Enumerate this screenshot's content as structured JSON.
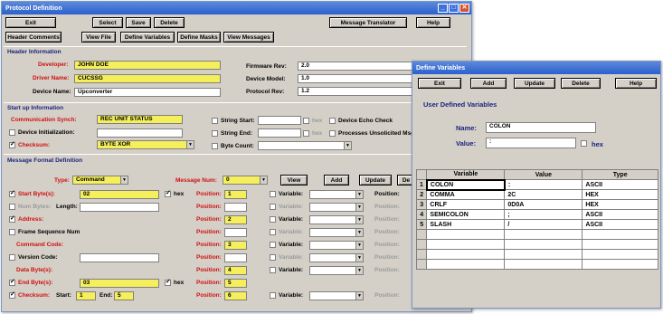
{
  "pd": {
    "title": "Protocol Definition",
    "toolbar1": {
      "exit": "Exit",
      "select": "Select",
      "save": "Save",
      "delete": "Delete",
      "msg_translator": "Message Translator",
      "help": "Help"
    },
    "toolbar2": {
      "header_comments": "Header Comments",
      "view_file": "View File",
      "define_variables": "Define Variables",
      "define_masks": "Define Masks",
      "view_messages": "View Messages"
    },
    "header": {
      "section": "Header Information",
      "developer_label": "Developer:",
      "developer": "JOHN DOE",
      "driver_label": "Driver Name:",
      "driver": "CUCSSG",
      "device_label": "Device Name:",
      "device": "Upconverter",
      "firmware_label": "Firmware Rev:",
      "firmware": "2.0",
      "model_label": "Device Model:",
      "model": "1.0",
      "protocol_label": "Protocol Rev:",
      "protocol": "1.2"
    },
    "startup": {
      "section": "Start up Information",
      "comm_label": "Communication Synch:",
      "comm": "REC UNIT STATUS",
      "devinit_label": "Device Initialization:",
      "checksum_label": "Checksum:",
      "checksum": "BYTE XOR",
      "string_start": "String Start:",
      "string_end": "String End:",
      "byte_count": "Byte Count:",
      "hex": "hex",
      "echo": "Device Echo Check",
      "unsolicited": "Processes Unsolicited Msg"
    },
    "format": {
      "section": "Message Format Definition",
      "type_label": "Type:",
      "type": "Command",
      "msgnum_label": "Message Num:",
      "msgnum": "0",
      "view": "View",
      "add": "Add",
      "update": "Update",
      "del": "De",
      "left": [
        {
          "label": "Start Byte(s):",
          "value": "02",
          "hex": "hex"
        },
        {
          "label": "Num Bytes:",
          "length": "Length:"
        },
        {
          "label": "Address:"
        },
        {
          "label": "Frame Sequence Num"
        },
        {
          "label": "Command Code:"
        },
        {
          "label": "Version Code:"
        },
        {
          "label": "Data Byte(s):"
        },
        {
          "label": "End Byte(s):",
          "value": "03",
          "hex": "hex"
        },
        {
          "label": "Checksum:",
          "start": "Start:",
          "start_v": "1",
          "end": "End:",
          "end_v": "5"
        }
      ],
      "pos_label": "Position:",
      "positions": [
        "1",
        "",
        "2",
        "",
        "3",
        "",
        "4",
        "5",
        "6"
      ],
      "var_label": "Variable:",
      "phys_label": "Position:"
    }
  },
  "dv": {
    "title": "Define Variables",
    "exit": "Exit",
    "add": "Add",
    "update": "Update",
    "delete": "Delete",
    "help": "Help",
    "section": "User Defined Variables",
    "name_label": "Name:",
    "name": "COLON",
    "value_label": "Value:",
    "value": ":",
    "hex": "hex",
    "columns": [
      "Variable",
      "Value",
      "Type"
    ],
    "rows": [
      {
        "n": "1",
        "v": "COLON",
        "val": ":",
        "t": "ASCII"
      },
      {
        "n": "2",
        "v": "COMMA",
        "val": "2C",
        "t": "HEX"
      },
      {
        "n": "3",
        "v": "CRLF",
        "val": "0D0A",
        "t": "HEX"
      },
      {
        "n": "4",
        "v": "SEMICOLON",
        "val": ";",
        "t": "ASCII"
      },
      {
        "n": "5",
        "v": "SLASH",
        "val": "/",
        "t": "ASCII"
      }
    ]
  }
}
